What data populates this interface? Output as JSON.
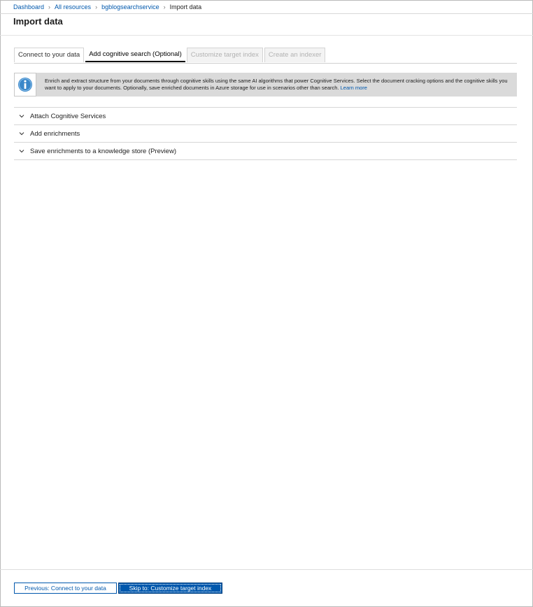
{
  "breadcrumb": {
    "items": [
      "Dashboard",
      "All resources",
      "bgblogsearchservice"
    ],
    "current": "Import data"
  },
  "page": {
    "title": "Import data"
  },
  "tabs": [
    {
      "label": "Connect to your data",
      "state": "normal"
    },
    {
      "label": "Add cognitive search (Optional)",
      "state": "active"
    },
    {
      "label": "Customize target index",
      "state": "disabled"
    },
    {
      "label": "Create an indexer",
      "state": "disabled"
    }
  ],
  "info": {
    "icon": "info-icon",
    "text": "Enrich and extract structure from your documents through cognitive skills using the same AI algorithms that power Cognitive Services. Select the document cracking options and the cognitive skills you want to apply to your documents. Optionally, save enriched documents in Azure storage for use in scenarios other than search.",
    "link": "Learn more"
  },
  "sections": [
    {
      "label": "Attach Cognitive Services",
      "icon": "chevron-down-icon"
    },
    {
      "label": "Add enrichments",
      "icon": "chevron-down-icon"
    },
    {
      "label": "Save enrichments to a knowledge store (Preview)",
      "icon": "chevron-down-icon"
    }
  ],
  "footer": {
    "previous_label": "Previous: Connect to your data",
    "skip_label": "Skip to: Customize target index"
  },
  "colors": {
    "link": "#0058ad",
    "primary_button": "#0058ad",
    "info_banner": "#dadada",
    "info_icon": "#3a87c9"
  }
}
